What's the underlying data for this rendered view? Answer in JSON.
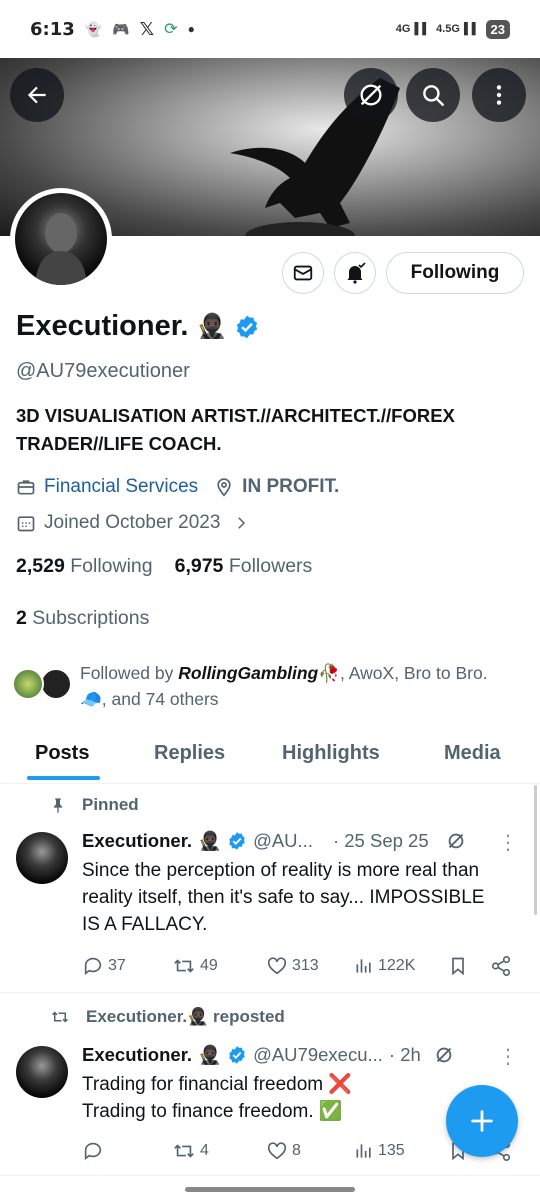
{
  "status_bar": {
    "time": "6:13",
    "left_icons": [
      "snapchat-icon",
      "discord-icon",
      "x-icon",
      "sync-icon",
      "dot-icon"
    ],
    "network1": "4G",
    "network2": "4.5G",
    "battery": "23"
  },
  "header": {
    "back_icon": "arrow-left-icon",
    "grok_icon": "grok-icon",
    "search_icon": "search-icon",
    "more_icon": "more-vertical-icon"
  },
  "profile": {
    "name": "Executioner.",
    "handle": "@AU79executioner",
    "bio": "3D VISUALISATION ARTIST.//ARCHITECT.//FOREX TRADER//LIFE COACH.",
    "category": "Financial Services",
    "location": "IN PROFIT.",
    "joined": "Joined October 2023",
    "following_count": "2,529",
    "following_label": "Following",
    "followers_count": "6,975",
    "followers_label": "Followers",
    "subscriptions_count": "2",
    "subscriptions_label": "Subscriptions",
    "followed_by_prefix": "Followed by ",
    "followed_by_name": "RollingGambling",
    "followed_by_rest": ", AwoX, Bro to Bro.",
    "followed_by_tail": ", and 74 others",
    "follow_button": "Following"
  },
  "tabs": [
    {
      "label": "Posts"
    },
    {
      "label": "Replies"
    },
    {
      "label": "Highlights"
    },
    {
      "label": "Media"
    }
  ],
  "posts": [
    {
      "pinned_label": "Pinned",
      "name": "Executioner.",
      "handle": "@AU...",
      "date": "· 25 Sep 25",
      "text": "Since the perception of reality is more real than reality itself, then it's safe to say... IMPOSSIBLE IS A FALLACY.",
      "replies": "37",
      "reposts": "49",
      "likes": "313",
      "views": "122K"
    },
    {
      "repost_label": "Executioner.",
      "repost_suffix": "reposted",
      "name": "Executioner.",
      "handle": "@AU79execu...",
      "date": "· 2h",
      "line1": "Trading for financial freedom ❌",
      "line2": "Trading to finance freedom.  ✅",
      "replies": "",
      "reposts": "4",
      "likes": "8",
      "views": "135"
    }
  ],
  "colors": {
    "accent": "#1d9bf0",
    "text": "#0f1419",
    "secondary": "#536471"
  }
}
